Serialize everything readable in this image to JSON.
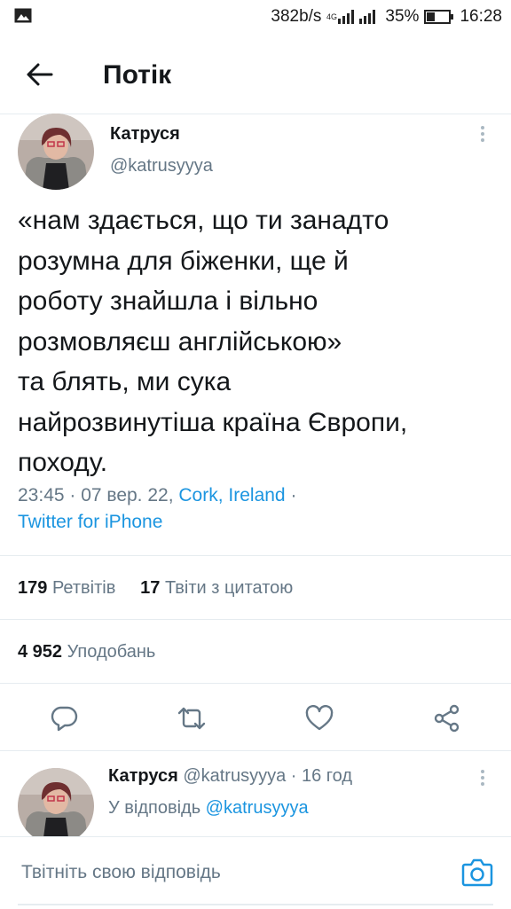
{
  "status_bar": {
    "speed": "382b/s",
    "network": "4G",
    "battery": "35%",
    "time": "16:28"
  },
  "header": {
    "title": "Потік"
  },
  "tweet": {
    "author_name": "Катруся",
    "author_handle": "@katrusyyya",
    "text": "«нам здається, що ти занадто\nрозумна для біженки, ще й\nроботу знайшла і вільно\nрозмовляєш англійською»\nта блять, ми сука\nнайрозвинутіша країна Європи,\nпоходу.",
    "time_date": "23:45 · 07 вер. 22, ",
    "location": "Cork, Ireland",
    "separator": " ·",
    "source": "Twitter for iPhone",
    "retweets_count": "179",
    "retweets_label": "Ретвітів",
    "quotes_count": "17",
    "quotes_label": "Твіти з цитатою",
    "likes_count": "4 952",
    "likes_label": "Уподобань"
  },
  "reply": {
    "author_name": "Катруся",
    "author_handle_time": "@katrusyyya · 16 год",
    "reply_prefix": "У відповідь ",
    "reply_to": "@katrusyyya"
  },
  "compose": {
    "placeholder": "Твітніть свою відповідь"
  },
  "colors": {
    "accent": "#1b95e0",
    "muted": "#657786",
    "text": "#14171a",
    "divider": "#e6ecf0"
  },
  "icons": [
    "image-icon",
    "signal-icon",
    "battery-icon",
    "back-arrow-icon",
    "more-icon",
    "reply-icon",
    "retweet-icon",
    "like-icon",
    "share-icon",
    "camera-icon"
  ]
}
